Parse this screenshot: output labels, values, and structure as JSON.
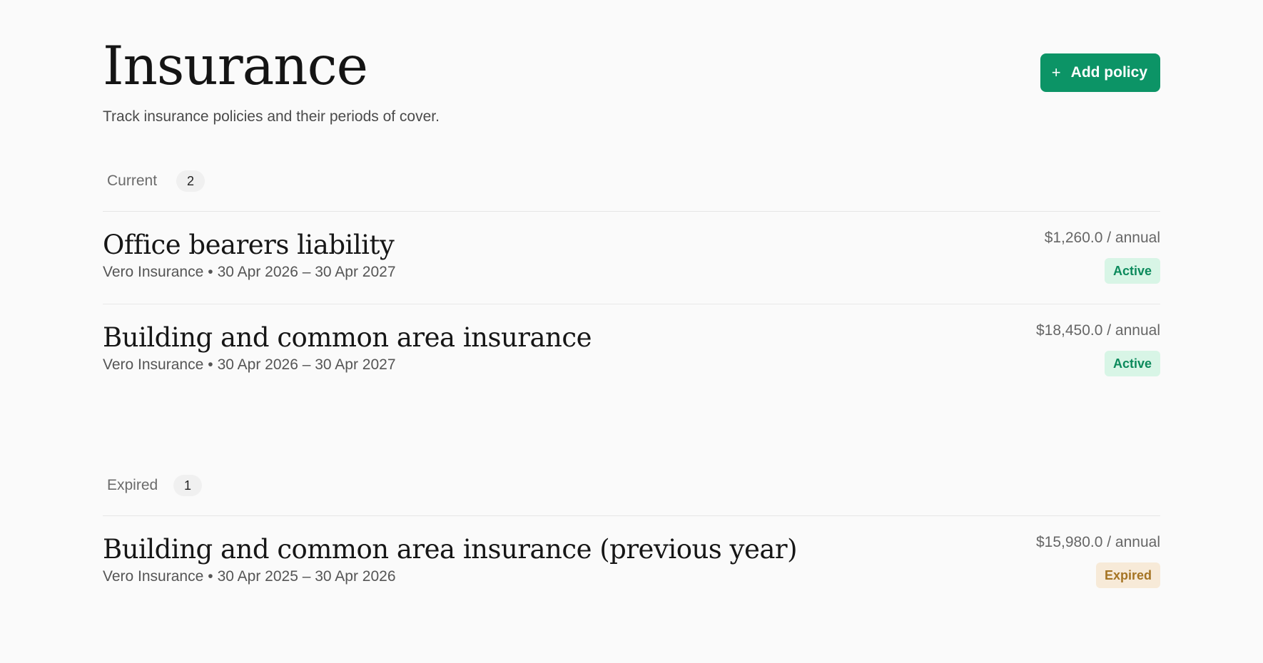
{
  "header": {
    "title": "Insurance",
    "subtitle": "Track insurance policies and their periods of cover.",
    "add_button_icon": "+",
    "add_button_label": "Add policy"
  },
  "sections": [
    {
      "label": "Current",
      "count": "2",
      "policies": [
        {
          "name": "Office bearers liability",
          "insurer": "Vero Insurance",
          "period": "30 Apr 2026 – 30 Apr 2027",
          "price": "$1,260.0 / annual",
          "status": "Active"
        },
        {
          "name": "Building and common area insurance",
          "insurer": "Vero Insurance",
          "period": "30 Apr 2026 – 30 Apr 2027",
          "price": "$18,450.0 / annual",
          "status": "Active"
        }
      ]
    },
    {
      "label": "Expired",
      "count": "1",
      "policies": [
        {
          "name": "Building and common area insurance (previous year)",
          "insurer": "Vero Insurance",
          "period": "30 Apr 2025 – 30 Apr 2026",
          "price": "$15,980.0 / annual",
          "status": "Expired"
        }
      ]
    }
  ],
  "separator": "•",
  "colors": {
    "accent": "#0c9466",
    "active_bg": "#d8f5e6",
    "active_text": "#0c8a5c",
    "expired_bg": "#f7ead8",
    "expired_text": "#a57423"
  }
}
